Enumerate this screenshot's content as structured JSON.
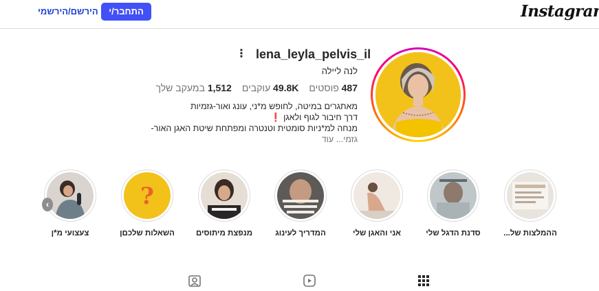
{
  "header": {
    "logo": "Instagram",
    "login_label": "התחבר/י",
    "signup_label": "הירשם/הירשמי"
  },
  "profile": {
    "username": "lena_leyla_pelvis_il",
    "full_name": "לנה ליילה",
    "stats": {
      "posts_value": "487",
      "posts_label": "פוסטים",
      "followers_value": "49.8K",
      "followers_label": "עוקבים",
      "following_value": "1,512",
      "following_label": "במעקב שלך"
    },
    "bio": {
      "line1": "מאתגרים במיטה, לחופש מ*ני, עונג ואור-גזמיות",
      "line2": "דרך חיבור לגוף ולאגן",
      "line2_emoji": "❗",
      "line3": "מנחה למ*ניות סומטית וטנטרה ומפתחת שיטת האגן האור-",
      "line4": "גזמי... עוד"
    }
  },
  "highlights": [
    {
      "label": "ההמלצות של..."
    },
    {
      "label": "סדנת הדגל שלי"
    },
    {
      "label": "אני והאגן שלי"
    },
    {
      "label": "המדריך לעינוג"
    },
    {
      "label": "מנפצת מיתוסים"
    },
    {
      "label": "השאלות שלכםן"
    },
    {
      "label": "צעצועי מ*ן"
    }
  ],
  "highlight_scroll_icon": "chevron-left-icon",
  "tabs": [
    {
      "icon": "grid-icon"
    },
    {
      "icon": "reels-icon"
    },
    {
      "icon": "tagged-icon"
    }
  ],
  "colors": {
    "accent": "#4150f7",
    "link": "#1f3fd6",
    "avatar_bg": "#f2c21a"
  }
}
